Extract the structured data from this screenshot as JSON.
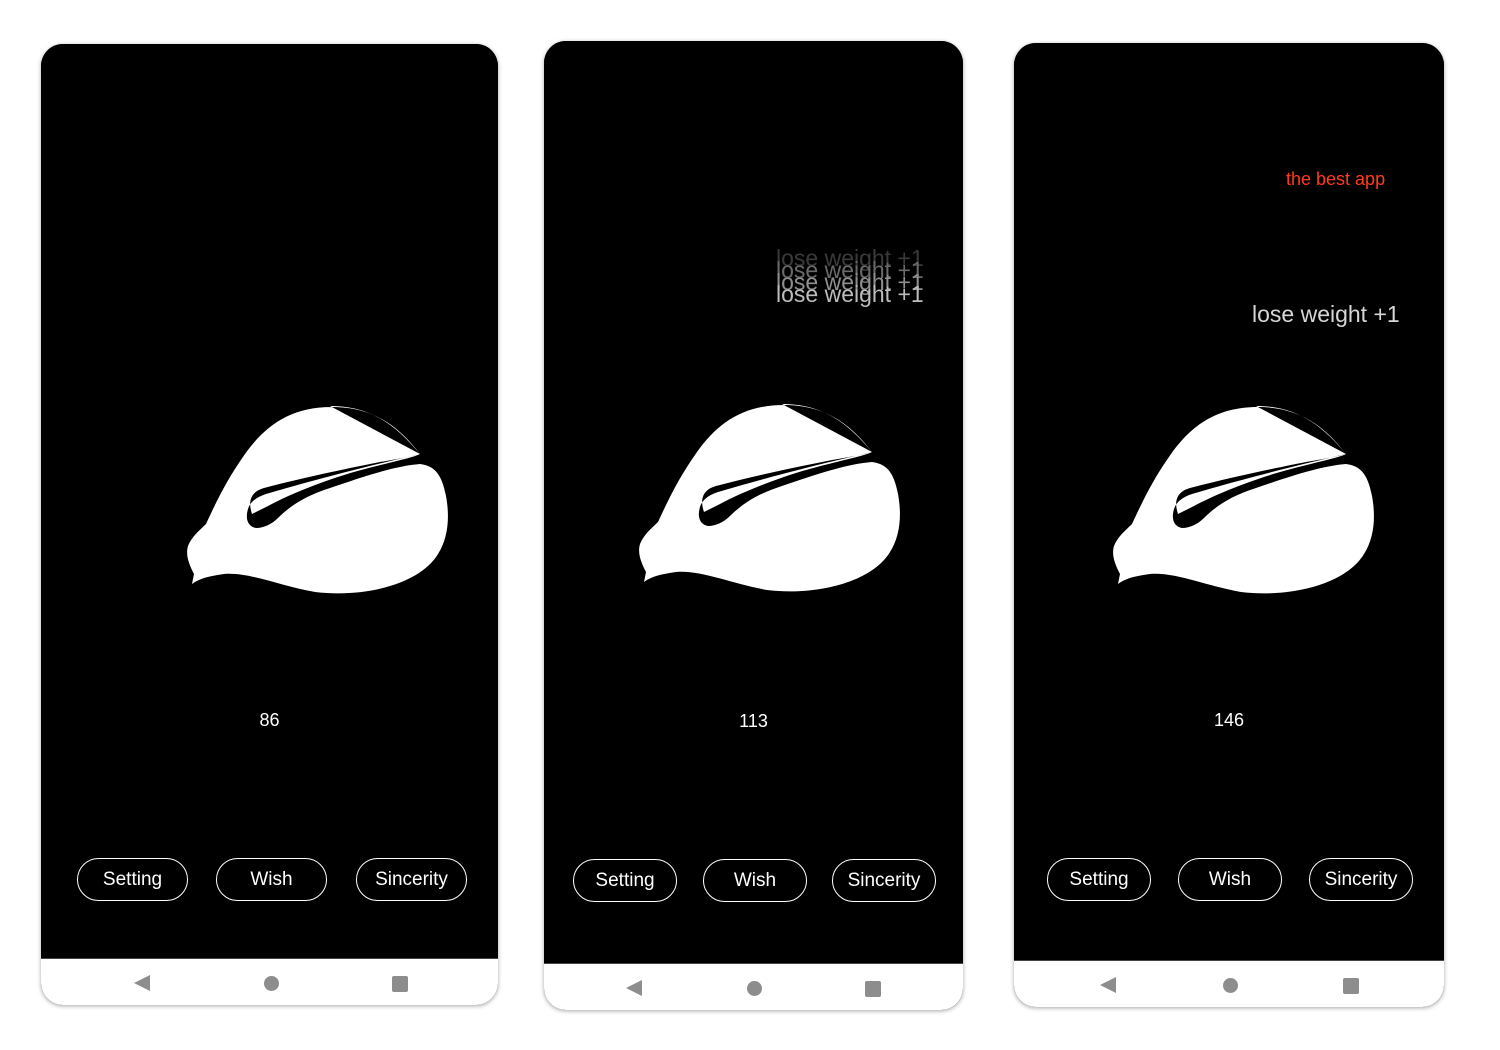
{
  "screens": [
    {
      "counter": "86",
      "buttons": {
        "setting": "Setting",
        "wish": "Wish",
        "sincerity": "Sincerity"
      }
    },
    {
      "counter": "113",
      "floating_texts": [
        "lose weight +1",
        "lose weight +1",
        "lose weight +1",
        "lose weight +1"
      ],
      "buttons": {
        "setting": "Setting",
        "wish": "Wish",
        "sincerity": "Sincerity"
      }
    },
    {
      "counter": "146",
      "tagline": "the best app",
      "floating_texts": [
        "lose weight +1"
      ],
      "buttons": {
        "setting": "Setting",
        "wish": "Wish",
        "sincerity": "Sincerity"
      }
    }
  ],
  "navbar": {
    "back_icon": "back-triangle-icon",
    "home_icon": "home-circle-icon",
    "recents_icon": "recents-square-icon"
  },
  "colors": {
    "background": "#000000",
    "tagline": "#ff3b1f",
    "nav_icons": "#8d8d8d"
  }
}
